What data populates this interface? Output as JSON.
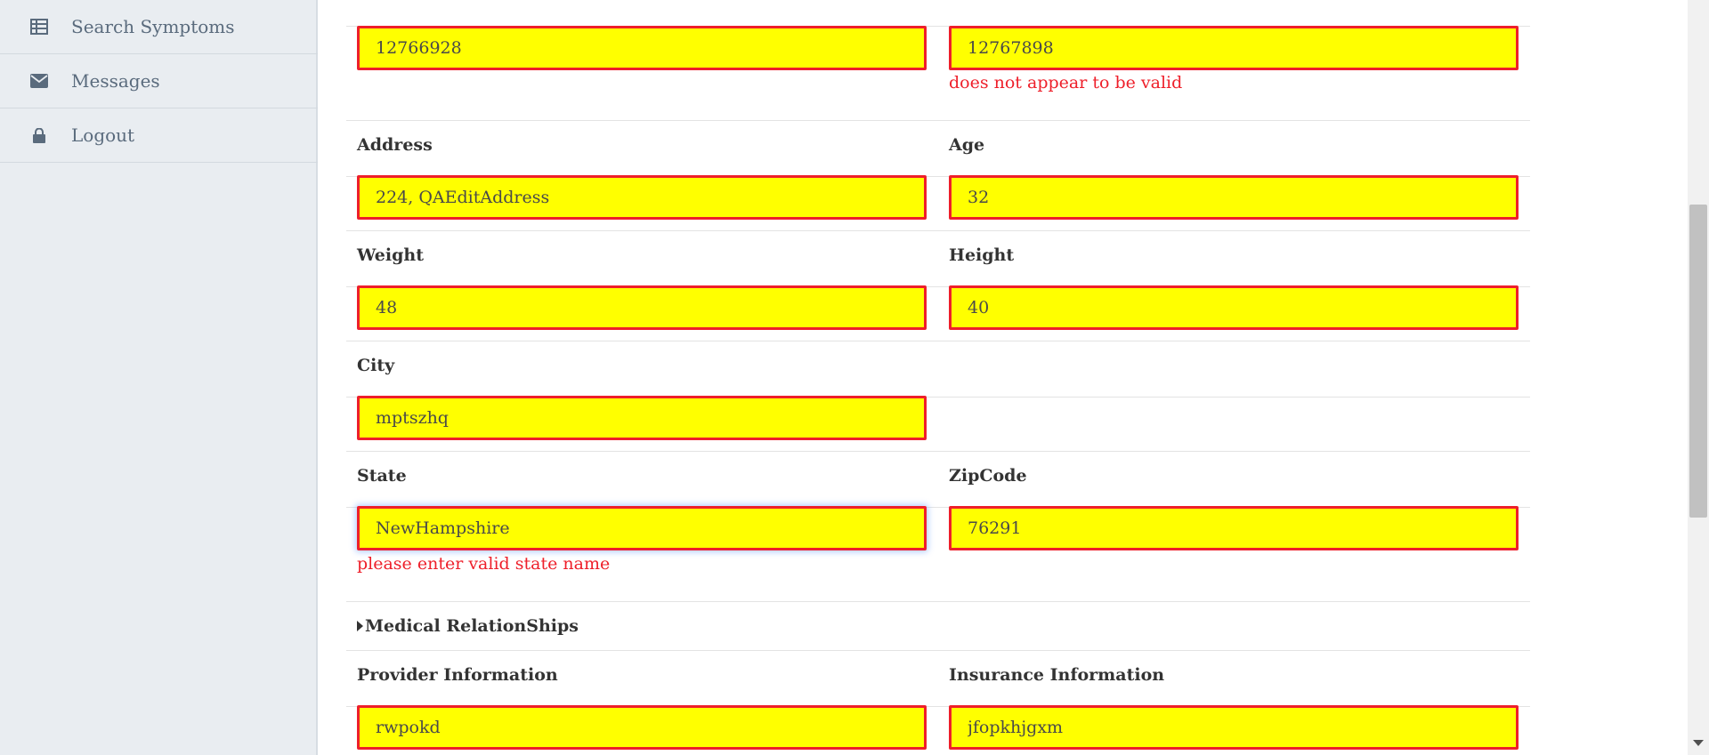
{
  "sidebar": {
    "items": [
      {
        "label": "Search Symptoms",
        "icon": "table-icon"
      },
      {
        "label": "Messages",
        "icon": "envelope-icon"
      },
      {
        "label": "Logout",
        "icon": "lock-icon"
      }
    ]
  },
  "form": {
    "top_left": {
      "value": "12766928"
    },
    "top_right": {
      "value": "12767898",
      "error": "does not appear to be valid"
    },
    "address": {
      "label": "Address",
      "value": "224, QAEditAddress"
    },
    "age": {
      "label": "Age",
      "value": "32"
    },
    "weight": {
      "label": "Weight",
      "value": "48"
    },
    "height": {
      "label": "Height",
      "value": "40"
    },
    "city": {
      "label": "City",
      "value": "mptszhq"
    },
    "state": {
      "label": "State",
      "value": "NewHampshire",
      "error": "please enter valid state name"
    },
    "zipcode": {
      "label": "ZipCode",
      "value": "76291"
    },
    "medical_relationships": {
      "label": "Medical RelationShips"
    },
    "provider": {
      "label": "Provider Information",
      "value": "rwpokd"
    },
    "insurance": {
      "label": "Insurance Information",
      "value": "jfopkhjgxm"
    }
  },
  "colors": {
    "input_bg": "#ffff00",
    "input_border": "#ee1f2a",
    "error_text": "#ee1f2a",
    "sidebar_bg": "#e9edf1"
  }
}
